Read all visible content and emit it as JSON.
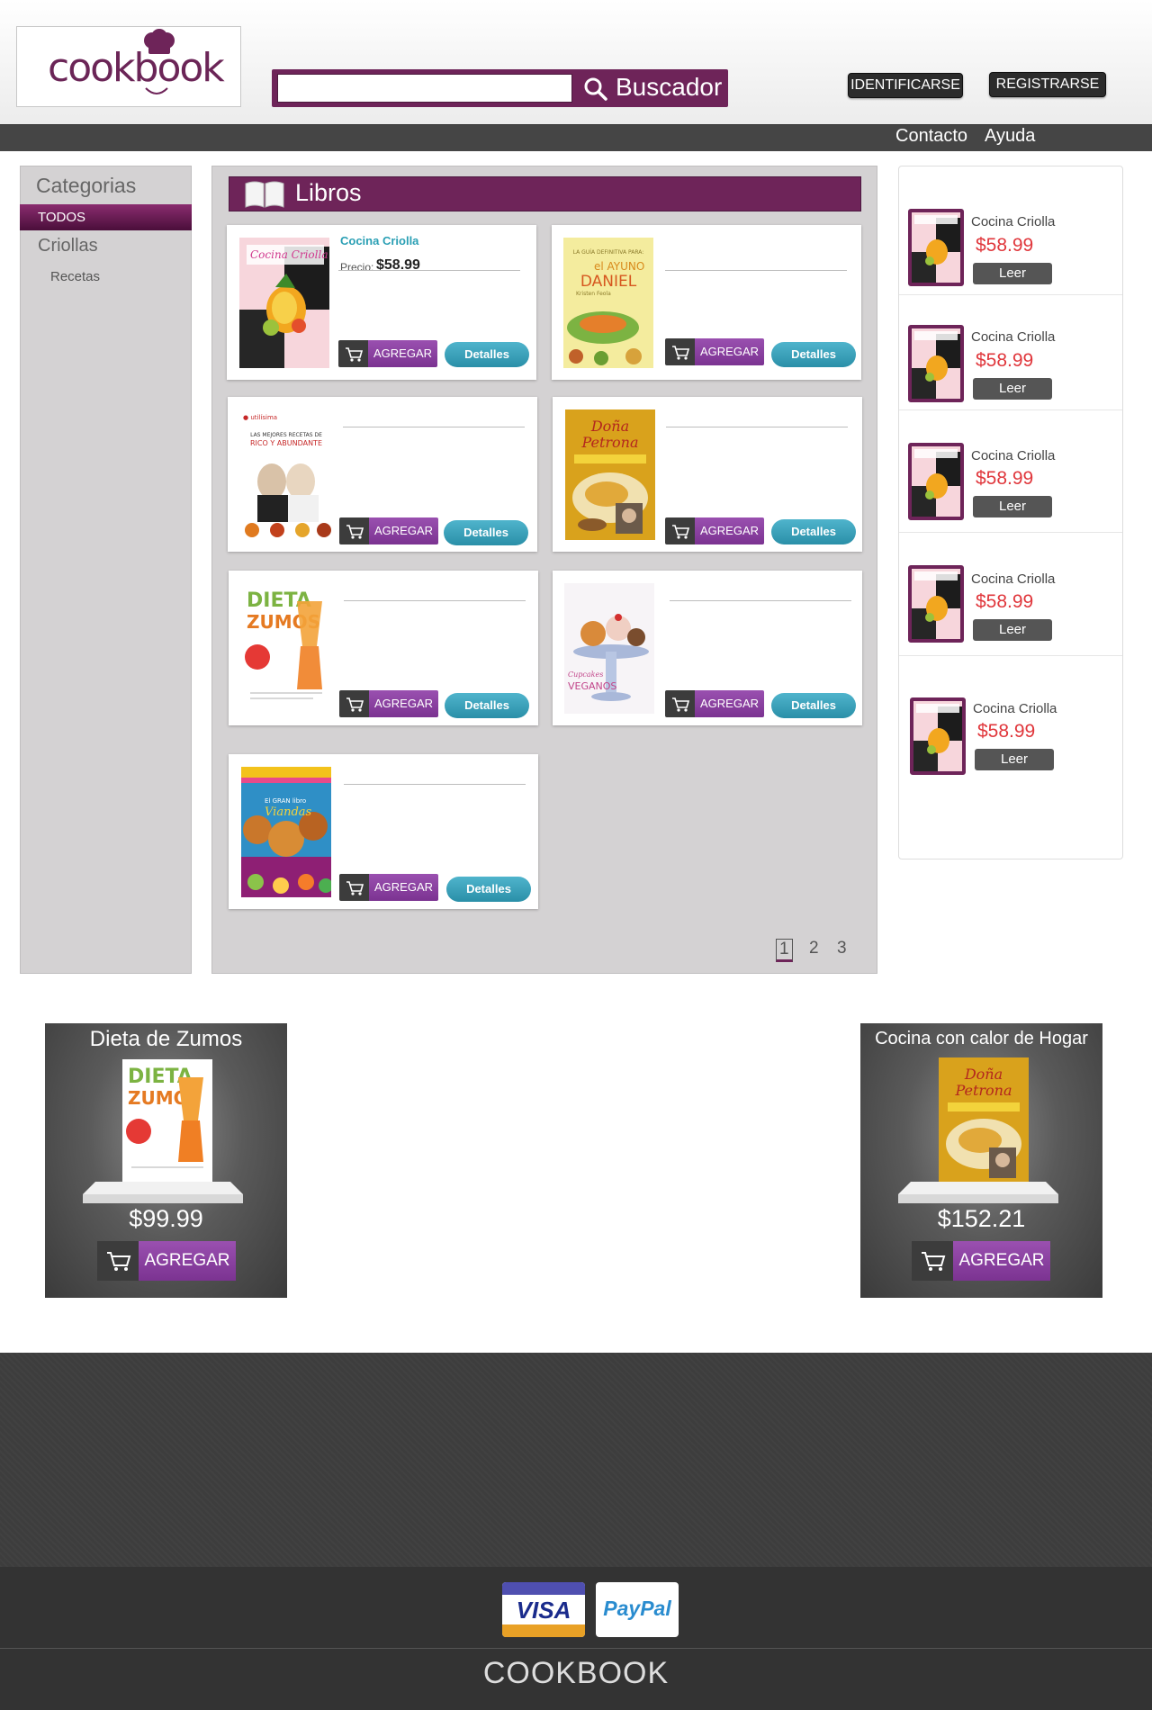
{
  "header": {
    "logo_text": "cookbook",
    "search": {
      "placeholder": "",
      "button_label": "Buscador"
    },
    "login_label": "IDENTIFICARSE",
    "register_label": "REGISTRARSE"
  },
  "nav": {
    "contact": "Contacto",
    "help": "Ayuda"
  },
  "categories": {
    "title": "Categorias",
    "active": "TODOS",
    "item": "Criollas",
    "sub_item": "Recetas"
  },
  "main": {
    "title": "Libros",
    "price_label": "Precio:",
    "add_label": "AGREGAR",
    "details_label": "Detalles",
    "books": [
      {
        "title": "Cocina Criolla",
        "price": "$58.99",
        "cover": "cocina-criolla"
      },
      {
        "title": "",
        "price": "",
        "cover": "ayuno-daniel"
      },
      {
        "title": "",
        "price": "",
        "cover": "rico-abundante"
      },
      {
        "title": "",
        "price": "",
        "cover": "dona-petrona"
      },
      {
        "title": "",
        "price": "",
        "cover": "dieta-zumos"
      },
      {
        "title": "",
        "price": "",
        "cover": "cupcakes-veganos"
      },
      {
        "title": "",
        "price": "",
        "cover": "gran-libro-viandas"
      }
    ],
    "pages": [
      "1",
      "2",
      "3"
    ],
    "current_page": "1"
  },
  "sidebar": {
    "read_label": "Leer",
    "items": [
      {
        "title": "Cocina Criolla",
        "price": "$58.99"
      },
      {
        "title": "Cocina Criolla",
        "price": "$58.99"
      },
      {
        "title": "Cocina Criolla",
        "price": "$58.99"
      },
      {
        "title": "Cocina Criolla",
        "price": "$58.99"
      },
      {
        "title": "Cocina Criolla",
        "price": "$58.99"
      }
    ]
  },
  "featured": [
    {
      "title": "Dieta de Zumos",
      "price": "$99.99",
      "add_label": "AGREGAR"
    },
    {
      "title": "Cocina con calor de Hogar",
      "price": "$152.21",
      "add_label": "AGREGAR"
    }
  ],
  "footer": {
    "payment_methods": [
      "VISA",
      "PayPal"
    ],
    "brand": "COOKBOOK"
  },
  "colors": {
    "brand_purple": "#6e2459",
    "button_purple": "#8a3fa1",
    "details_teal": "#2a9fb4",
    "price_red": "#e0363b",
    "footer_dark": "#333333"
  }
}
